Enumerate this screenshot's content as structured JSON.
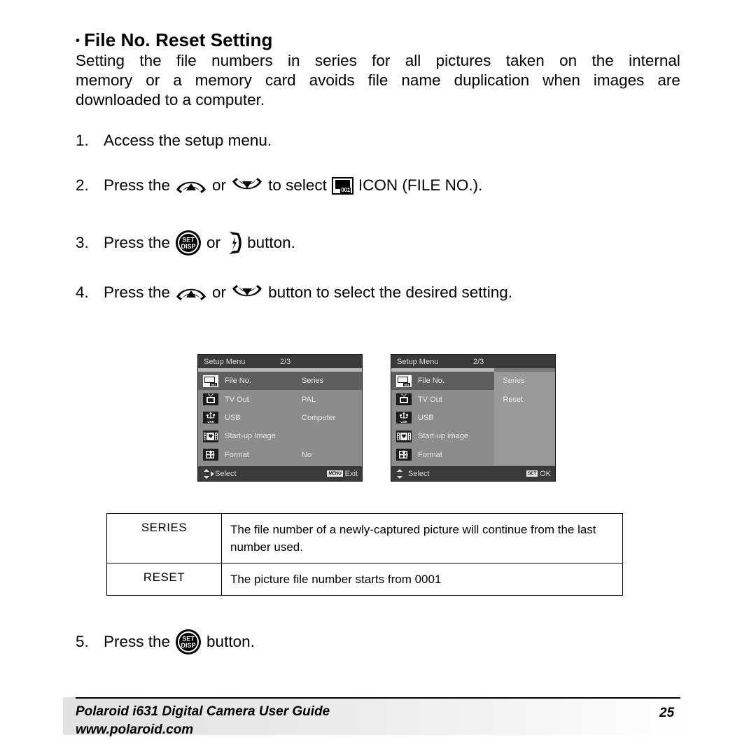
{
  "heading": {
    "bullet": "•",
    "text": "File No. Reset Setting"
  },
  "intro": {
    "line1": [
      "Setting",
      "the",
      "file",
      "numbers",
      "in",
      "series",
      "for",
      "all",
      "pictures",
      "taken",
      "on",
      "the",
      "internal"
    ],
    "line2": [
      "memory",
      "or",
      "a",
      "memory",
      "card",
      "avoids",
      "file",
      "name",
      "duplication",
      "when",
      "images",
      "are"
    ],
    "line3": "downloaded to a computer."
  },
  "steps": {
    "s1": {
      "num": "1.",
      "text": "Access the setup menu."
    },
    "s2": {
      "num": "2.",
      "a": "Press the",
      "b": "or",
      "c": "to select",
      "d": "ICON (FILE NO.)."
    },
    "s3": {
      "num": "3.",
      "a": "Press the",
      "b": "or",
      "c": "button."
    },
    "s4": {
      "num": "4.",
      "a": "Press the",
      "b": "or",
      "c": "button to select the desired setting."
    },
    "s5": {
      "num": "5.",
      "a": "Press the",
      "c": "button."
    }
  },
  "icons": {
    "up_button": "up-arrow-button-icon",
    "down_button": "down-arrow-button-icon",
    "set_disp_button": "set-disp-button-icon",
    "flash_right_button": "flash-right-button-icon",
    "file_no_icon": "file-no-icon",
    "file_no_label": "001",
    "set_disp_top": "SET",
    "set_disp_bottom": "DISP"
  },
  "lcd_left": {
    "title": "Setup Menu",
    "page": "2/3",
    "rows": [
      {
        "icon": "file-no-icon",
        "label": "File No.",
        "value": "Series",
        "selected": true
      },
      {
        "icon": "tv-out-icon",
        "label": "TV Out",
        "value": "PAL",
        "selected": false
      },
      {
        "icon": "usb-icon",
        "label": "USB",
        "value": "Computer",
        "selected": false
      },
      {
        "icon": "start-up-image-icon",
        "label": "Start-up Image",
        "value": "",
        "selected": false
      },
      {
        "icon": "format-icon",
        "label": "Format",
        "value": "No",
        "selected": false
      }
    ],
    "footer_select": "Select",
    "footer_badge": "MENU",
    "footer_action": "Exit"
  },
  "lcd_right": {
    "title": "Setup Menu",
    "page": "2/3",
    "rows": [
      {
        "icon": "file-no-icon",
        "label": "File No.",
        "selected": true
      },
      {
        "icon": "tv-out-icon",
        "label": "TV Out",
        "selected": false
      },
      {
        "icon": "usb-icon",
        "label": "USB",
        "selected": false
      },
      {
        "icon": "start-up-image-icon",
        "label": "Start-up image",
        "selected": false
      },
      {
        "icon": "format-icon",
        "label": "Format",
        "selected": false
      }
    ],
    "options": [
      "Series",
      "Reset"
    ],
    "footer_select": "Select",
    "footer_badge": "SET",
    "footer_action": "OK"
  },
  "table": {
    "rows": [
      {
        "key": "SERIES",
        "value": "The file number of a newly-captured picture will continue from the last number used."
      },
      {
        "key": "RESET",
        "value": "The picture file number starts from 0001"
      }
    ]
  },
  "footer": {
    "title": "Polaroid i631 Digital Camera User Guide",
    "url": "www.polaroid.com",
    "page_number": "25"
  },
  "colors": {
    "lcd_bg": "#8c8c8c",
    "lcd_header": "#3a3a3a",
    "lcd_selected_row": "#5e5e5e",
    "lcd_subpanel": "#9a9a9a",
    "text": "#000000"
  }
}
